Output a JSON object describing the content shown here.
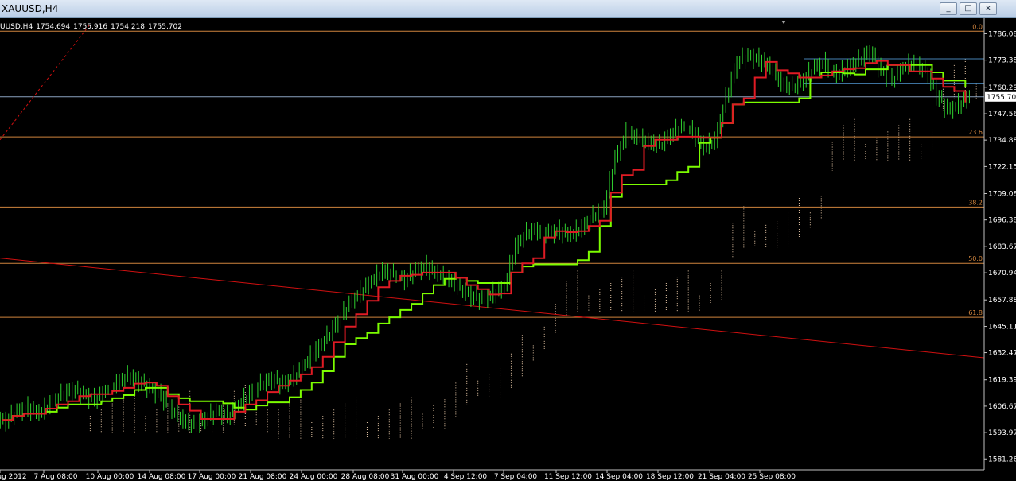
{
  "window": {
    "title": "XAUUSD,H4",
    "buttons": [
      "_",
      "□",
      "×"
    ]
  },
  "info": {
    "symbol": "UUSD,H4",
    "open": "1754.694",
    "high": "1755.916",
    "low": "1754.218",
    "close": "1755.702"
  },
  "chart_data": {
    "type": "candlestick",
    "symbol": "XAUUSD",
    "timeframe": "H4",
    "ylim": [
      1576,
      1792
    ],
    "last_price": 1755.7,
    "y_ticks": [
      "1786.08",
      "1773.38",
      "1760.29",
      "1747.56",
      "1734.88",
      "1722.15",
      "1709.08",
      "1696.38",
      "1683.67",
      "1670.94",
      "1657.88",
      "1645.11",
      "1632.47",
      "1619.39",
      "1606.67",
      "1593.97",
      "1581.26"
    ],
    "x_ticks": [
      "ug 2012",
      "7 Aug 08:00",
      "10 Aug 00:00",
      "14 Aug 08:00",
      "17 Aug 00:00",
      "21 Aug 08:00",
      "24 Aug 00:00",
      "28 Aug 08:00",
      "31 Aug 00:00",
      "4 Sep 12:00",
      "7 Sep 04:00",
      "11 Sep 12:00",
      "14 Sep 04:00",
      "18 Sep 12:00",
      "21 Sep 04:00",
      "25 Sep 08:00"
    ],
    "fib_levels": [
      {
        "label": "0.0",
        "price": 1787.3
      },
      {
        "label": "23.6",
        "price": 1736.4
      },
      {
        "label": "38.2",
        "price": 1702.6
      },
      {
        "label": "50.0",
        "price": 1675.5
      },
      {
        "label": "61.8",
        "price": 1649.5
      }
    ],
    "horizontal_lines": [
      1774.0,
      1762.0
    ],
    "candles_approx": [
      1600,
      1604,
      1606,
      1603,
      1608,
      1612,
      1615,
      1612,
      1610,
      1614,
      1618,
      1621,
      1619,
      1615,
      1612,
      1604,
      1600,
      1597,
      1601,
      1604,
      1602,
      1607,
      1613,
      1617,
      1620,
      1617,
      1621,
      1627,
      1634,
      1640,
      1648,
      1656,
      1662,
      1667,
      1672,
      1670,
      1668,
      1672,
      1674,
      1670,
      1668,
      1663,
      1660,
      1658,
      1661,
      1664,
      1684,
      1690,
      1692,
      1690,
      1691,
      1689,
      1693,
      1698,
      1703,
      1726,
      1738,
      1736,
      1734,
      1732,
      1738,
      1741,
      1739,
      1731,
      1735,
      1755,
      1773,
      1775,
      1774,
      1770,
      1762,
      1760,
      1764,
      1770,
      1772,
      1766,
      1770,
      1773,
      1778,
      1768,
      1764,
      1770,
      1772,
      1768,
      1757,
      1749,
      1752,
      1756
    ]
  },
  "colors": {
    "background": "#000000",
    "candle": "#2fd12f",
    "fib": "#d0843d",
    "hline": "#4682b4",
    "tenkan": "#e01b24",
    "kijun": "#7cfc00",
    "cloud": "#e8c9a8",
    "trend": "#d01010",
    "text": "#ffffff"
  }
}
